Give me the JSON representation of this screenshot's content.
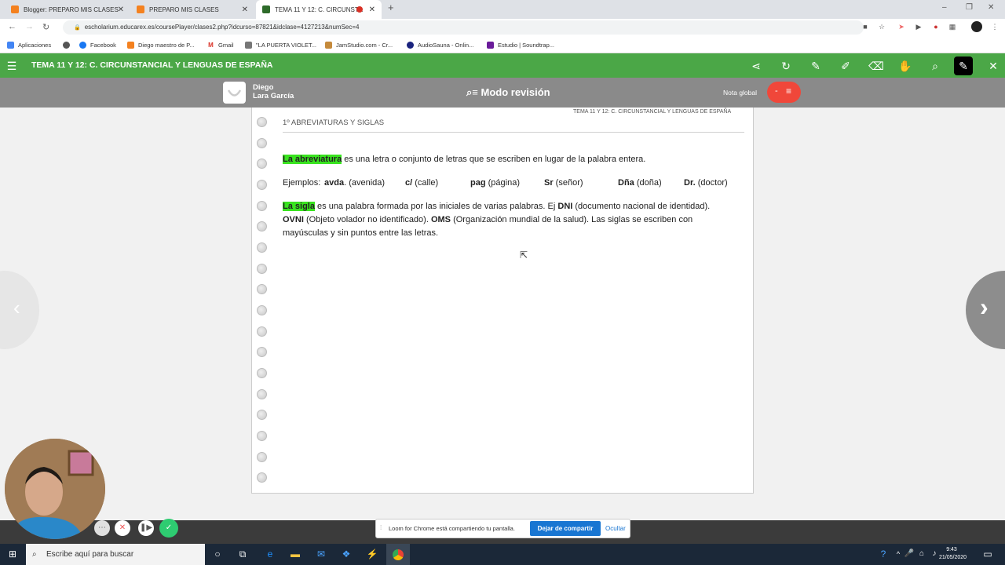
{
  "browser": {
    "tabs": [
      {
        "label": "Blogger: PREPARO MIS CLASES",
        "color": "#f4811f"
      },
      {
        "label": "PREPARO MIS CLASES",
        "color": "#f4811f"
      },
      {
        "label": "TEMA 11 Y 12: C. CIRCUNST...",
        "color": "#2e6b2a"
      }
    ],
    "url": "escholarium.educarex.es/coursePlayer/clases2.php?idcurso=87821&idclase=4127213&numSec=4",
    "bookmarks": [
      "Aplicaciones",
      "Facebook",
      "Diego maestro de P...",
      "Gmail",
      "\"LA PUERTA VIOLET...",
      "JamStudio.com - Cr...",
      "AudioSauna - Onlin...",
      "Estudio | Soundtrap..."
    ]
  },
  "app": {
    "title": "TEMA 11 Y 12: C. CIRCUNSTANCIAL Y LENGUAS DE ESPAÑA",
    "user_first": "Diego",
    "user_last": "Lara García",
    "mode": "Modo revisión",
    "nota_label": "Nota global",
    "nota_value": "-",
    "brand_color": "#4ba747"
  },
  "page": {
    "header_right": "TEMA 11 Y 12: C. CIRCUNSTANCIAL Y LENGUAS DE ESPAÑA",
    "section": "1º ABREVIATURAS Y SIGLAS",
    "p1_hl": "La abreviatura",
    "p1_rest": " es una letra o conjunto de letras que se escriben en lugar de la palabra entera.",
    "examples_label": "Ejemplos:",
    "examples": [
      {
        "abbr": "avda",
        "suffix": ".",
        "meaning": " (avenida)"
      },
      {
        "abbr": "c/",
        "suffix": "",
        "meaning": " (calle)"
      },
      {
        "abbr": "pag",
        "suffix": "",
        "meaning": " (página)"
      },
      {
        "abbr": "Sr",
        "suffix": "",
        "meaning": " (señor)"
      },
      {
        "abbr": "Dña",
        "suffix": "",
        "meaning": " (doña)"
      },
      {
        "abbr": "Dr.",
        "suffix": "",
        "meaning": " (doctor)"
      }
    ],
    "p3_hl": "La sigla",
    "p3_a": " es una palabra formada por las iniciales de varias palabras. Ej ",
    "p3_b1": "DNI",
    "p3_c": " (documento nacional de identidad).",
    "p3_b2": "OVNI",
    "p3_d": " (Objeto volador no identificado). ",
    "p3_b3": "OMS",
    "p3_e": " (Organización mundial  de la salud). Las siglas se escriben con",
    "p3_f": "mayúsculas y sin puntos entre las letras."
  },
  "loom": {
    "message": "Loom for Chrome está compartiendo tu pantalla.",
    "stop": "Dejar de compartir",
    "hide": "Ocultar"
  },
  "taskbar": {
    "search": "Escribe aquí para buscar",
    "time": "9:43",
    "date": "21/05/2020"
  }
}
